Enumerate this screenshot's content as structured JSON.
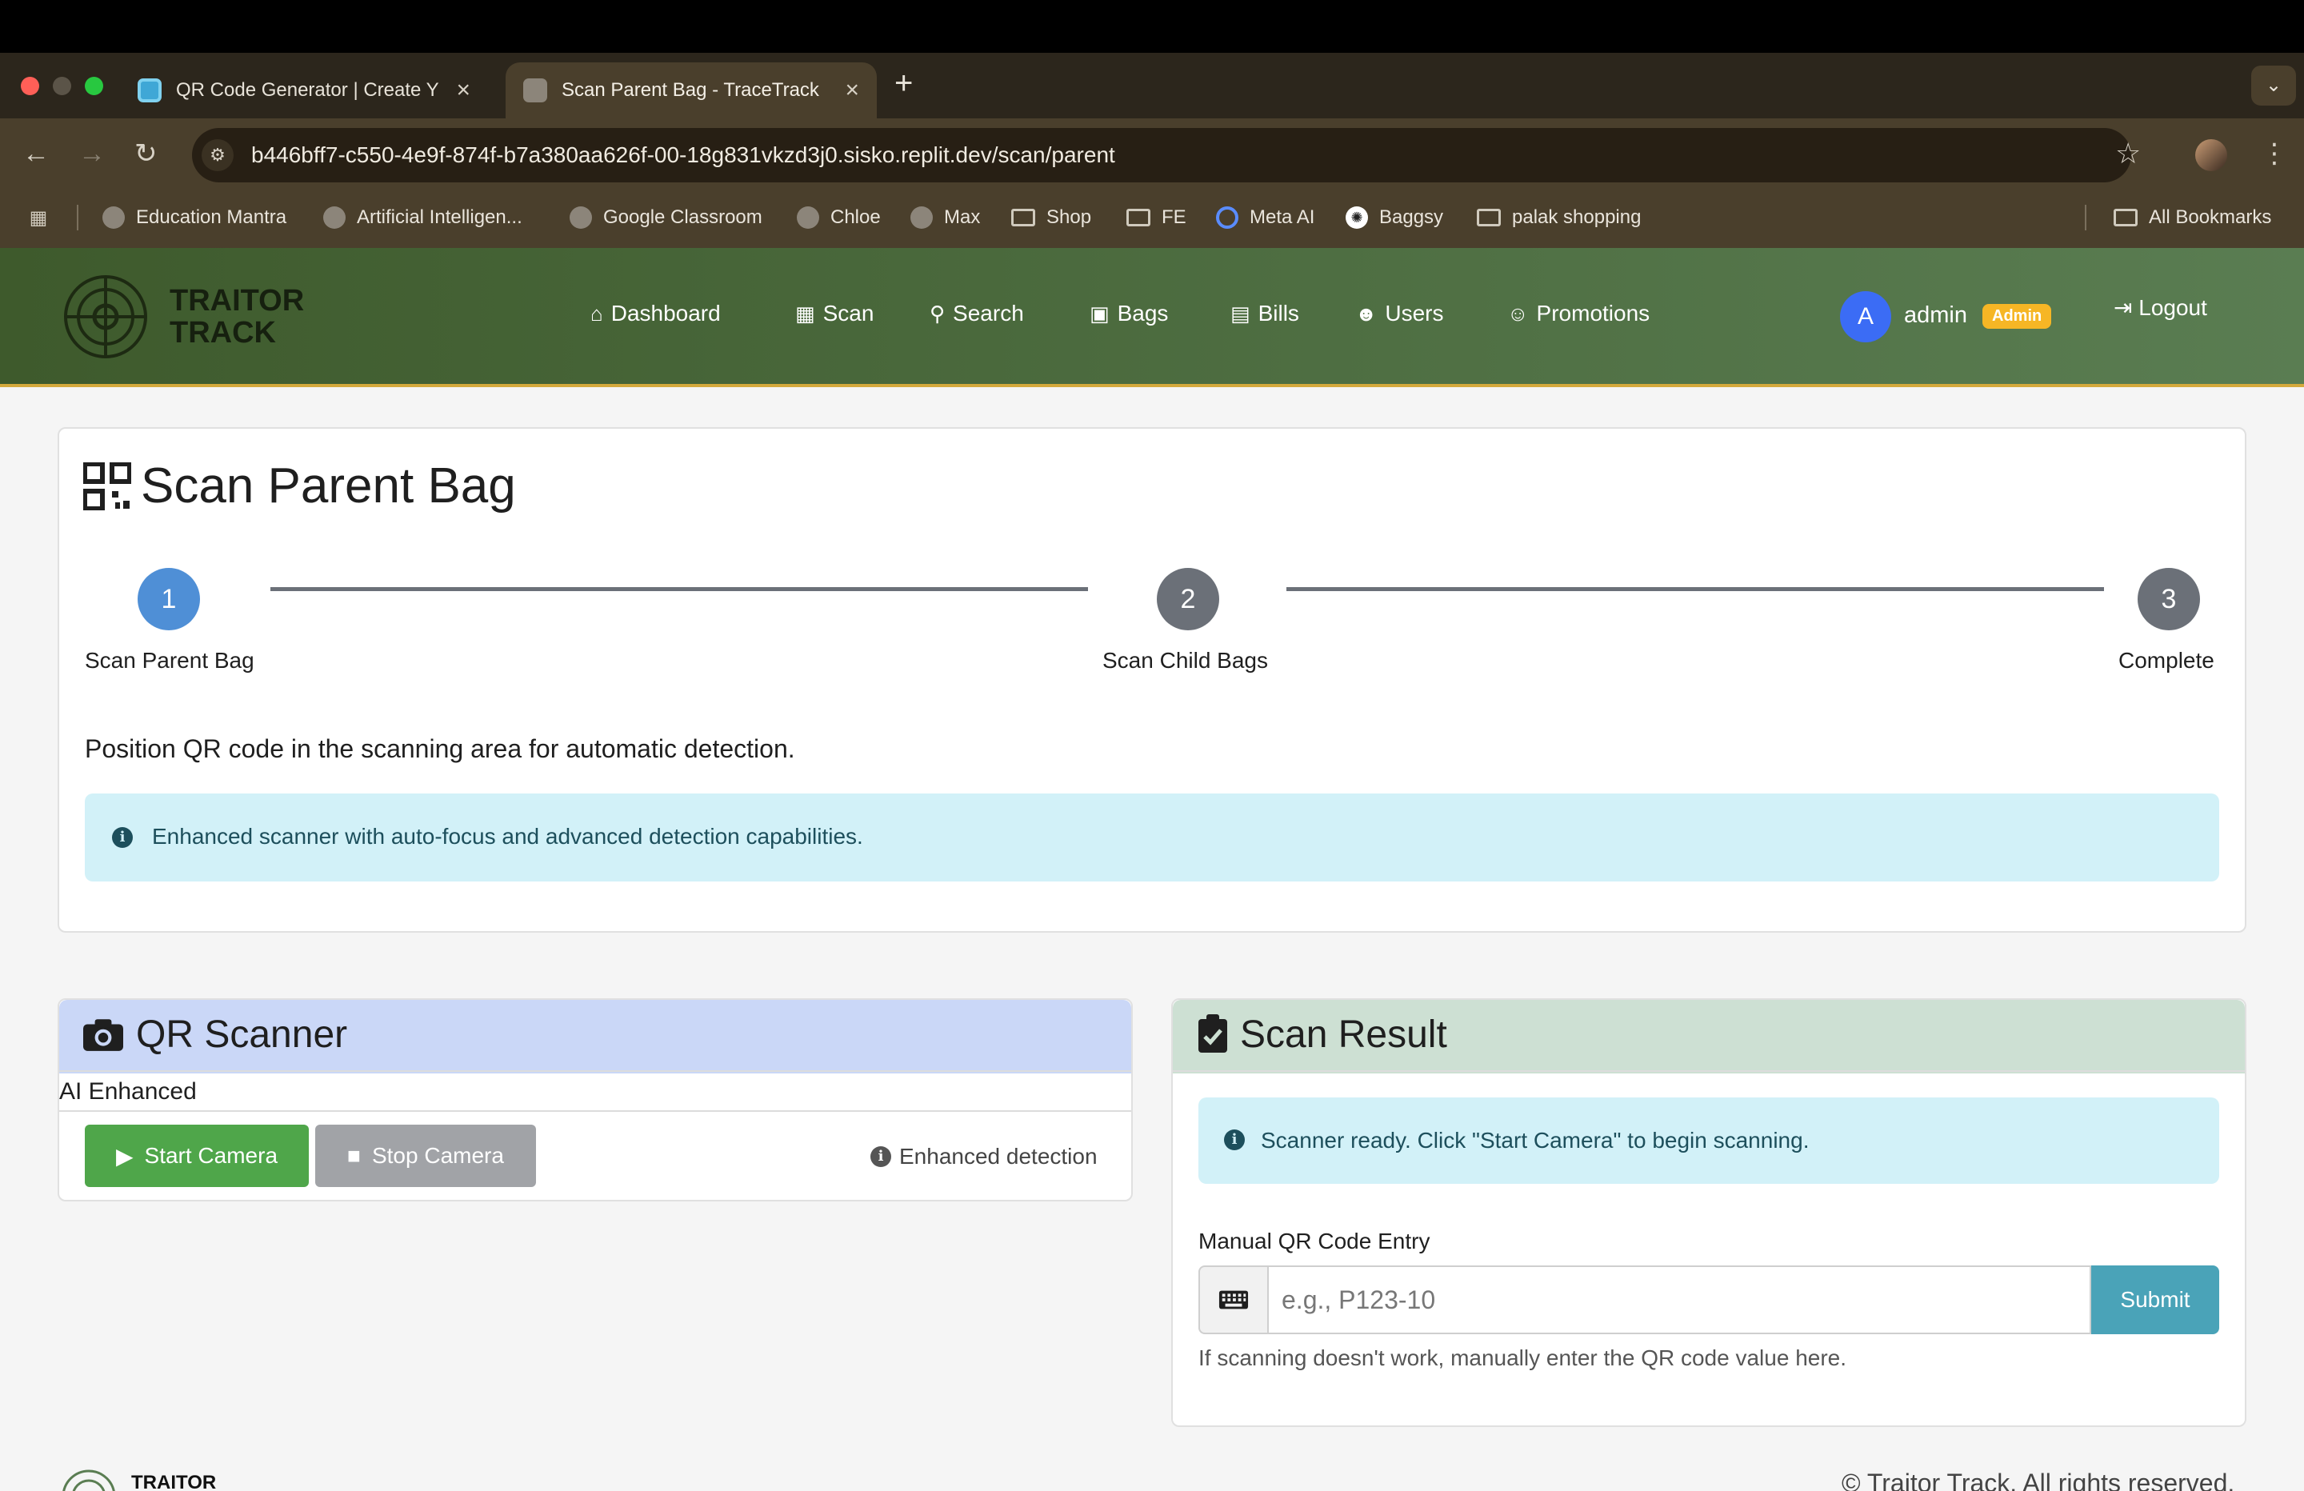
{
  "browser": {
    "tabs": [
      {
        "title": "QR Code Generator | Create Y",
        "active": false
      },
      {
        "title": "Scan Parent Bag - TraceTrack",
        "active": true
      }
    ],
    "url": "b446bff7-c550-4e9f-874f-b7a380aa626f-00-18g831vkzd3j0.sisko.replit.dev/scan/parent",
    "bookmarks": [
      "Education Mantra",
      "Artificial Intelligen...",
      "Google Classroom",
      "Chloe",
      "Max",
      "Shop",
      "FE",
      "Meta AI",
      "Baggsy",
      "palak shopping"
    ],
    "all_bookmarks": "All Bookmarks"
  },
  "app": {
    "logo_line1": "TRAITOR",
    "logo_line2": "TRACK",
    "nav": [
      "Dashboard",
      "Scan",
      "Search",
      "Bags",
      "Bills",
      "Users",
      "Promotions"
    ],
    "user": {
      "initial": "A",
      "name": "admin",
      "role": "Admin"
    },
    "logout": "Logout",
    "accent": "#d4a93c"
  },
  "page": {
    "title": "Scan Parent Bag",
    "steps": [
      {
        "number": "1",
        "label": "Scan Parent Bag",
        "state": "active"
      },
      {
        "number": "2",
        "label": "Scan Child Bags",
        "state": "pending"
      },
      {
        "number": "3",
        "label": "Complete",
        "state": "pending"
      }
    ],
    "instruction": "Position QR code in the scanning area for automatic detection.",
    "info_alert": "Enhanced scanner with auto-focus and advanced detection capabilities."
  },
  "scanner": {
    "title": "QR Scanner",
    "subtitle": "AI Enhanced",
    "start": "Start Camera",
    "stop": "Stop Camera",
    "detection": "Enhanced detection"
  },
  "result": {
    "title": "Scan Result",
    "status": "Scanner ready. Click \"Start Camera\" to begin scanning.",
    "manual_label": "Manual QR Code Entry",
    "placeholder": "e.g., P123-10",
    "submit": "Submit",
    "help": "If scanning doesn't work, manually enter the QR code value here."
  },
  "footer": {
    "brand": "TRAITOR",
    "copyright": "© Traitor Track. All rights reserved."
  }
}
